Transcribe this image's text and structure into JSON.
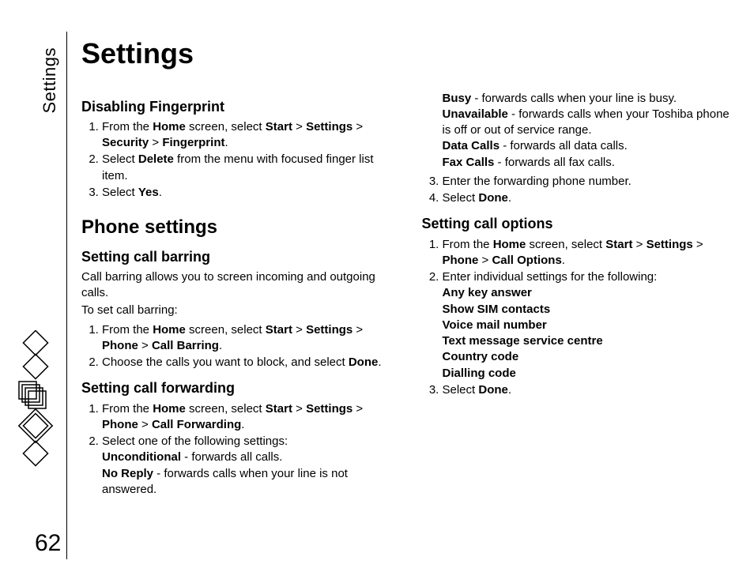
{
  "meta": {
    "chapter_tab": "Settings",
    "page_number": "62",
    "title": "Settings"
  },
  "left": {
    "sub1_heading": "Disabling Fingerprint",
    "sub1_li1_a": "From the ",
    "sub1_li1_home": "Home",
    "sub1_li1_b": " screen, select ",
    "sub1_li1_start": "Start",
    "sub1_li1_gt1": " > ",
    "sub1_li1_settings": "Settings",
    "sub1_li1_gt2": " > ",
    "sub1_li1_security": "Security",
    "sub1_li1_gt3": " > ",
    "sub1_li1_fingerprint": "Fingerprint",
    "sub1_li1_end": ".",
    "sub1_li2_a": "Select ",
    "sub1_li2_delete": "Delete",
    "sub1_li2_b": " from the menu with focused finger list item.",
    "sub1_li3_a": "Select ",
    "sub1_li3_yes": "Yes",
    "sub1_li3_end": ".",
    "h2_phone": "Phone settings",
    "sub2_heading": "Setting call barring",
    "sub2_intro1": "Call barring allows you to screen incoming and outgoing calls.",
    "sub2_intro2": "To set call barring:",
    "sub2_li1_a": "From the ",
    "sub2_li1_home": "Home",
    "sub2_li1_b": " screen, select ",
    "sub2_li1_start": "Start",
    "sub2_li1_gt1": " > ",
    "sub2_li1_settings": "Settings",
    "sub2_li1_gt2": " > ",
    "sub2_li1_phone": "Phone",
    "sub2_li1_gt3": " > ",
    "sub2_li1_callbarring": "Call Barring",
    "sub2_li1_end": ".",
    "sub2_li2_a": "Choose the calls you want to block, and select ",
    "sub2_li2_done": "Done",
    "sub2_li2_end": ".",
    "sub3_heading": "Setting call forwarding",
    "sub3_li1_a": "From the ",
    "sub3_li1_home": "Home",
    "sub3_li1_b": " screen, select ",
    "sub3_li1_start": "Start",
    "sub3_li1_gt1": " > ",
    "sub3_li1_settings": "Settings",
    "sub3_li1_gt2": " > ",
    "sub3_li1_phone": "Phone",
    "sub3_li1_gt3": " > ",
    "sub3_li1_callfwd": "Call Forwarding",
    "sub3_li1_end": ".",
    "sub3_li2_a": "Select one of the following settings:",
    "sub3_li2_unc": "Unconditional",
    "sub3_li2_unc_d": " - forwards all calls.",
    "sub3_li2_nr": "No Reply",
    "sub3_li2_nr_d": " - forwards calls when your line is not answered."
  },
  "right": {
    "cont_busy": "Busy",
    "cont_busy_d": " - forwards calls when your line is busy.",
    "cont_unav": "Unavailable",
    "cont_unav_d": " - forwards calls when your Toshiba phone is off or out of service range.",
    "cont_data": "Data Calls",
    "cont_data_d": " - forwards all data calls.",
    "cont_fax": "Fax Calls",
    "cont_fax_d": " - forwards all fax calls.",
    "cont_li3": "Enter the forwarding phone number.",
    "cont_li4_a": "Select ",
    "cont_li4_done": "Done",
    "cont_li4_end": ".",
    "sub4_heading": "Setting call options",
    "sub4_li1_a": "From the ",
    "sub4_li1_home": "Home",
    "sub4_li1_b": " screen, select ",
    "sub4_li1_start": "Start",
    "sub4_li1_gt1": " > ",
    "sub4_li1_settings": "Settings",
    "sub4_li1_gt2": " > ",
    "sub4_li1_phone": "Phone",
    "sub4_li1_gt3": " > ",
    "sub4_li1_callopt": "Call Options",
    "sub4_li1_end": ".",
    "sub4_li2_a": "Enter individual settings for the following:",
    "sub4_li2_o1": "Any key answer",
    "sub4_li2_o2": "Show SIM contacts",
    "sub4_li2_o3": "Voice mail number",
    "sub4_li2_o4": "Text message service centre",
    "sub4_li2_o5": "Country code",
    "sub4_li2_o6": "Dialling code",
    "sub4_li3_a": "Select ",
    "sub4_li3_done": "Done",
    "sub4_li3_end": "."
  }
}
